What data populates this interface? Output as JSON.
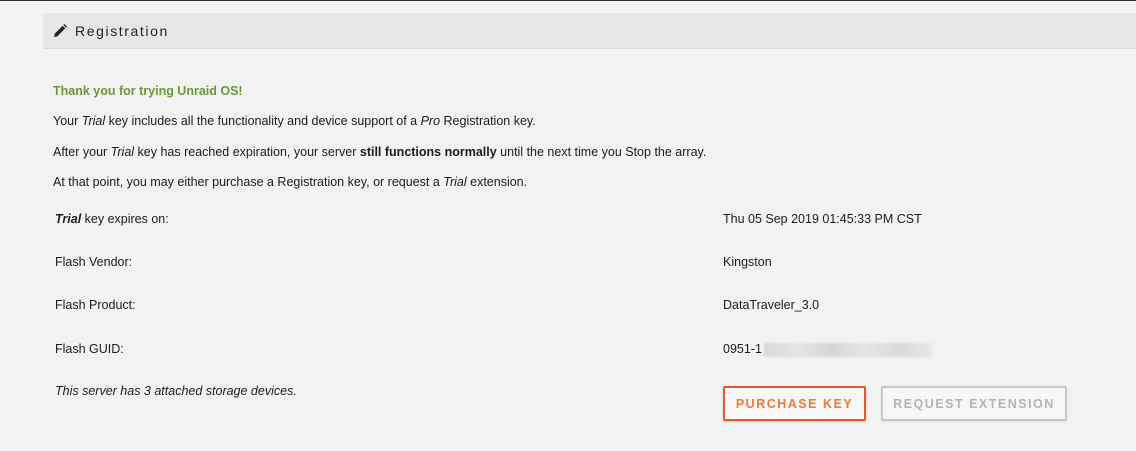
{
  "header": {
    "title": "Registration",
    "icon": "pencil-icon"
  },
  "messages": {
    "thanks": "Thank you for trying Unraid OS!",
    "line1": {
      "prefix": "Your ",
      "trial": "Trial",
      "mid": " key includes all the functionality and device support of a ",
      "pro": "Pro",
      "suffix": " Registration key."
    },
    "line2": {
      "prefix": "After your ",
      "trial": "Trial",
      "mid": " key has reached expiration, your server ",
      "bold": "still functions normally",
      "mid2": " until the next time you ",
      "stop": "Stop",
      "suffix": " the array."
    },
    "line3": {
      "prefix": "At that point, you may either purchase a Registration key, or request a ",
      "trial": "Trial",
      "suffix": " extension."
    }
  },
  "details": {
    "expires_trial": "Trial",
    "expires_label": " key expires on:",
    "expires_value": "Thu 05 Sep 2019 01:45:33 PM CST",
    "vendor_label": "Flash Vendor:",
    "vendor_value": "Kingston",
    "product_label": "Flash Product:",
    "product_value": "DataTraveler_3.0",
    "guid_label": "Flash GUID:",
    "guid_value": "0951-1",
    "devices_note": "This server has 3 attached storage devices."
  },
  "buttons": {
    "purchase": "PURCHASE KEY",
    "extension": "REQUEST EXTENSION"
  },
  "colors": {
    "accent_orange": "#e05a2a",
    "green_text": "#6a9a35"
  }
}
